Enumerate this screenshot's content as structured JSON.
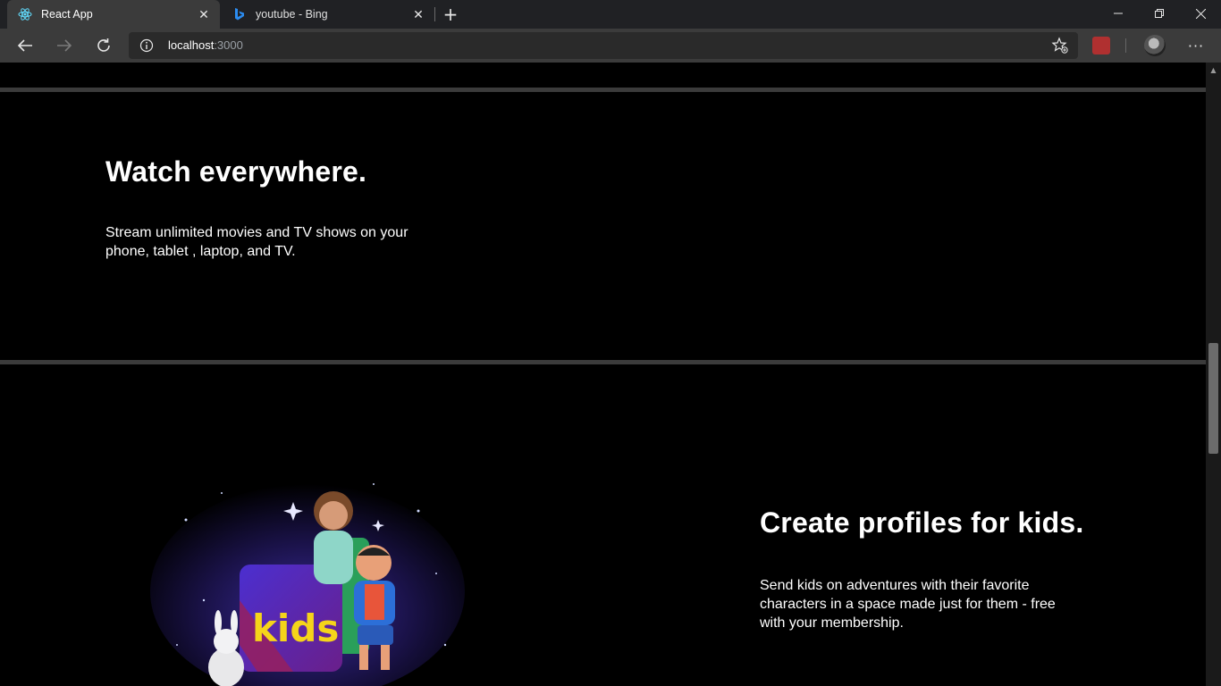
{
  "browser": {
    "tabs": [
      {
        "title": "React App",
        "icon": "react-icon",
        "active": true
      },
      {
        "title": "youtube - Bing",
        "icon": "bing-icon",
        "active": false
      }
    ],
    "url_host": "localhost",
    "url_port": ":3000"
  },
  "sections": {
    "watch": {
      "heading": "Watch everywhere.",
      "body": "Stream unlimited movies and TV shows on your phone, tablet , laptop, and TV."
    },
    "kids": {
      "heading": "Create profiles for kids.",
      "body": "Send kids on adventures with their favorite characters in a space made just for them - free with your membership.",
      "image_label": "kids"
    }
  },
  "colors": {
    "page_bg": "#000000",
    "divider": "#3b3b3b",
    "tabbar": "#202124",
    "toolbar": "#3b3b3b"
  }
}
